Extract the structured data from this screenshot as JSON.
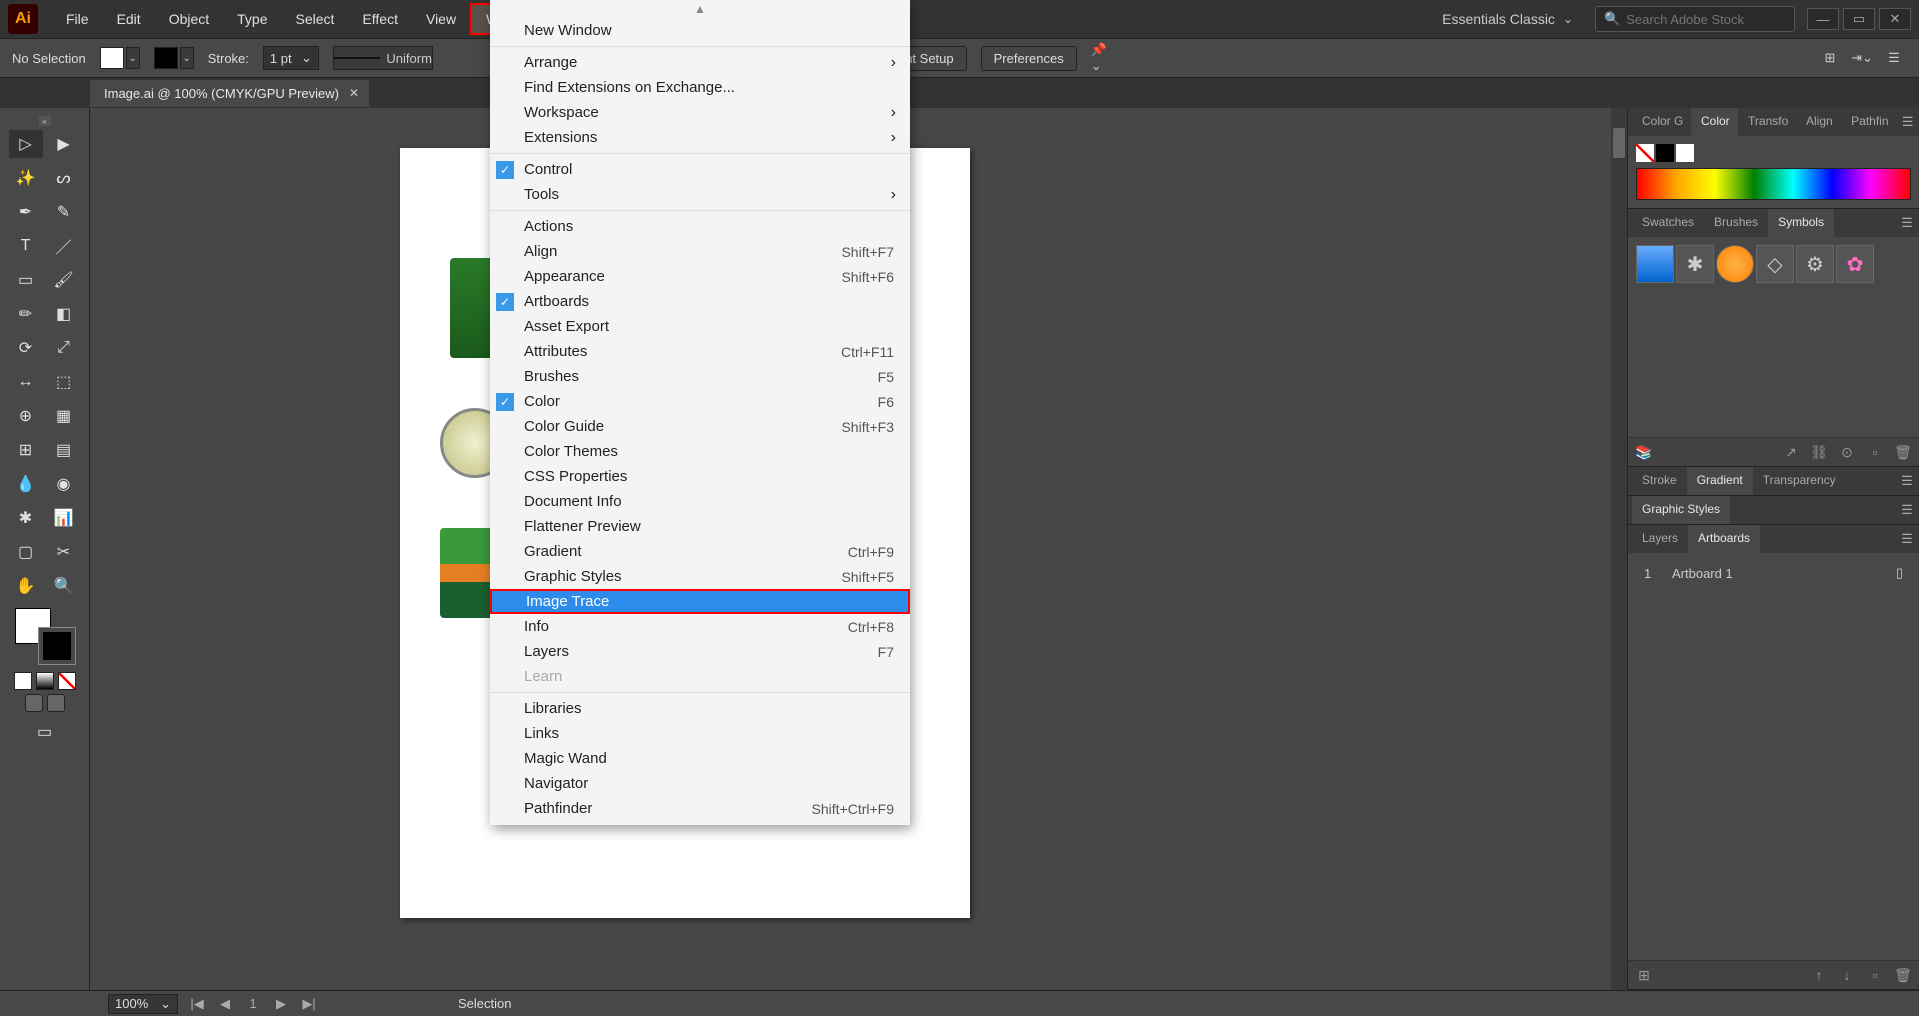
{
  "menubar": {
    "items": [
      "File",
      "Edit",
      "Object",
      "Type",
      "Select",
      "Effect",
      "View",
      "Window"
    ],
    "workspace": "Essentials Classic",
    "search_placeholder": "Search Adobe Stock"
  },
  "controlbar": {
    "selection": "No Selection",
    "stroke_label": "Stroke:",
    "stroke_value": "1 pt",
    "stroke_style": "Uniform",
    "doc_setup": "ument Setup",
    "preferences": "Preferences"
  },
  "doc_tab": "Image.ai @ 100% (CMYK/GPU Preview)",
  "window_menu": [
    {
      "type": "arrow"
    },
    {
      "label": "New Window"
    },
    {
      "type": "sep"
    },
    {
      "label": "Arrange",
      "sub": true
    },
    {
      "label": "Find Extensions on Exchange..."
    },
    {
      "label": "Workspace",
      "sub": true
    },
    {
      "label": "Extensions",
      "sub": true
    },
    {
      "type": "sep"
    },
    {
      "label": "Control",
      "check": true
    },
    {
      "label": "Tools",
      "sub": true
    },
    {
      "type": "sep"
    },
    {
      "label": "Actions"
    },
    {
      "label": "Align",
      "shortcut": "Shift+F7"
    },
    {
      "label": "Appearance",
      "shortcut": "Shift+F6"
    },
    {
      "label": "Artboards",
      "check": true
    },
    {
      "label": "Asset Export"
    },
    {
      "label": "Attributes",
      "shortcut": "Ctrl+F11"
    },
    {
      "label": "Brushes",
      "shortcut": "F5"
    },
    {
      "label": "Color",
      "shortcut": "F6",
      "check": true
    },
    {
      "label": "Color Guide",
      "shortcut": "Shift+F3"
    },
    {
      "label": "Color Themes"
    },
    {
      "label": "CSS Properties"
    },
    {
      "label": "Document Info"
    },
    {
      "label": "Flattener Preview"
    },
    {
      "label": "Gradient",
      "shortcut": "Ctrl+F9"
    },
    {
      "label": "Graphic Styles",
      "shortcut": "Shift+F5"
    },
    {
      "label": "Image Trace",
      "highlighted": true
    },
    {
      "label": "Info",
      "shortcut": "Ctrl+F8"
    },
    {
      "label": "Layers",
      "shortcut": "F7"
    },
    {
      "label": "Learn",
      "disabled": true
    },
    {
      "type": "sep"
    },
    {
      "label": "Libraries"
    },
    {
      "label": "Links"
    },
    {
      "label": "Magic Wand"
    },
    {
      "label": "Navigator"
    },
    {
      "label": "Pathfinder",
      "shortcut": "Shift+Ctrl+F9"
    }
  ],
  "panels": {
    "color": {
      "tabs": [
        "Color G",
        "Color",
        "Transfo",
        "Align",
        "Pathfin"
      ],
      "active": 1
    },
    "swatches": {
      "tabs": [
        "Swatches",
        "Brushes",
        "Symbols"
      ],
      "active": 2
    },
    "gradient": {
      "tabs": [
        "Stroke",
        "Gradient",
        "Transparency"
      ],
      "active": 1
    },
    "styles": {
      "tabs": [
        "Graphic Styles"
      ],
      "active": 0
    },
    "artboards": {
      "tabs": [
        "Layers",
        "Artboards"
      ],
      "active": 1,
      "rows": [
        {
          "num": "1",
          "name": "Artboard 1"
        }
      ]
    }
  },
  "statusbar": {
    "zoom": "100%",
    "mode": "Selection"
  }
}
